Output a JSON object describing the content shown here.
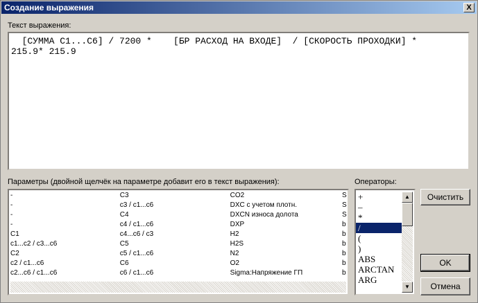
{
  "window": {
    "title": "Создание выражения",
    "close_label": "X"
  },
  "expression": {
    "label": "Текст выражения:",
    "text": "  [СУММА С1...С6] / 7200 *    [БР РАСХОД НА ВХОДЕ]  / [СКОРОСТЬ ПРОХОДКИ] *\n215.9* 215.9"
  },
  "params": {
    "label": "Параметры (двойной щелчёк на параметре добавит его в текст выражения):",
    "rows": [
      [
        "-",
        "C3",
        "CO2",
        "S"
      ],
      [
        "-",
        "c3 / c1...c6",
        "DXC с учетом плотн.",
        "S"
      ],
      [
        "-",
        "C4",
        "DXCN износа долота",
        "S"
      ],
      [
        "-",
        "c4 / c1...c6",
        "DXP",
        "b"
      ],
      [
        "C1",
        "c4...c6 / c3",
        "H2",
        "b"
      ],
      [
        "c1...c2 / c3...c6",
        "C5",
        "H2S",
        "b"
      ],
      [
        "C2",
        "c5 / c1...c6",
        "N2",
        "b"
      ],
      [
        "c2 / c1...c6",
        "C6",
        "O2",
        "b"
      ],
      [
        "c2...c6 / c1...c6",
        "c6 / c1...c6",
        "Sigma:Напряжение ГП",
        "b"
      ]
    ]
  },
  "operators": {
    "label": "Операторы:",
    "items": [
      "+",
      "–",
      "*",
      "/",
      "(",
      ")",
      "ABS",
      "ARCTAN",
      "ARG"
    ],
    "selected_index": 3
  },
  "buttons": {
    "clear": "Очистить",
    "ok": "OK",
    "cancel": "Отмена"
  }
}
